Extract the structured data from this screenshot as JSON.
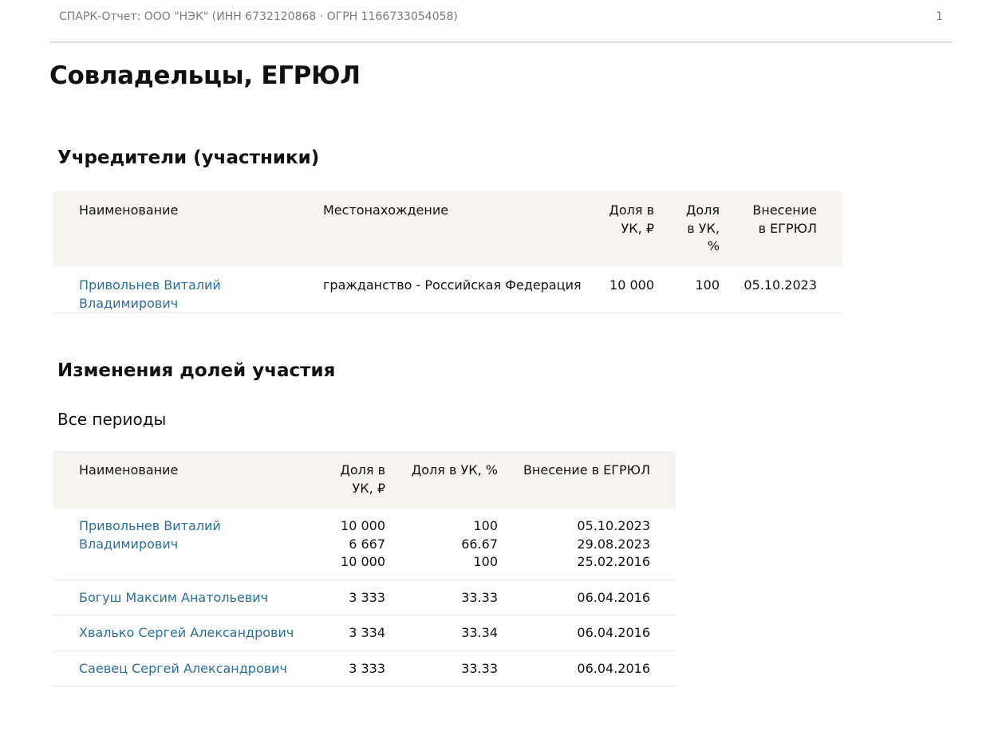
{
  "header": {
    "report_title": "СПАРК-Отчет: ООО \"НЭК\" (ИНН 6732120868 · ОГРН 1166733054058)",
    "page_number": "1"
  },
  "section": {
    "title_bold": "Совладельцы,",
    "title_regular": " ЕГРЮЛ"
  },
  "founders": {
    "heading": "Учредители (участники)",
    "columns": {
      "name": "Наименование",
      "location": "Местонахождение",
      "share_rub_line1": "Доля в",
      "share_rub_line2": "УК, ₽",
      "share_pct_line1": "Доля",
      "share_pct_line2": "в УК,",
      "share_pct_line3": "%",
      "date_line1": "Внесение",
      "date_line2": "в ЕГРЮЛ"
    },
    "rows": [
      {
        "name": "Привольнев Виталий Владимирович",
        "location": "гражданство - Российская Федерация",
        "share_rub": "10 000",
        "share_pct": "100",
        "date": "05.10.2023"
      }
    ]
  },
  "changes": {
    "heading": "Изменения долей участия",
    "period": "Все периоды",
    "columns": {
      "name": "Наименование",
      "share_rub_line1": "Доля в",
      "share_rub_line2": "УК, ₽",
      "share_pct": "Доля в УК, %",
      "date": "Внесение в ЕГРЮЛ"
    },
    "rows": [
      {
        "name": "Привольнев Виталий Владимирович",
        "share_rub": [
          "10 000",
          "6 667",
          "10 000"
        ],
        "share_pct": [
          "100",
          "66.67",
          "100"
        ],
        "date": [
          "05.10.2023",
          "29.08.2023",
          "25.02.2016"
        ]
      },
      {
        "name": "Богуш Максим Анатольевич",
        "share_rub": [
          "3 333"
        ],
        "share_pct": [
          "33.33"
        ],
        "date": [
          "06.04.2016"
        ]
      },
      {
        "name": "Хвалько Сергей Александрович",
        "share_rub": [
          "3 334"
        ],
        "share_pct": [
          "33.34"
        ],
        "date": [
          "06.04.2016"
        ]
      },
      {
        "name": "Саевец Сергей Александрович",
        "share_rub": [
          "3 333"
        ],
        "share_pct": [
          "33.33"
        ],
        "date": [
          "06.04.2016"
        ]
      }
    ]
  }
}
